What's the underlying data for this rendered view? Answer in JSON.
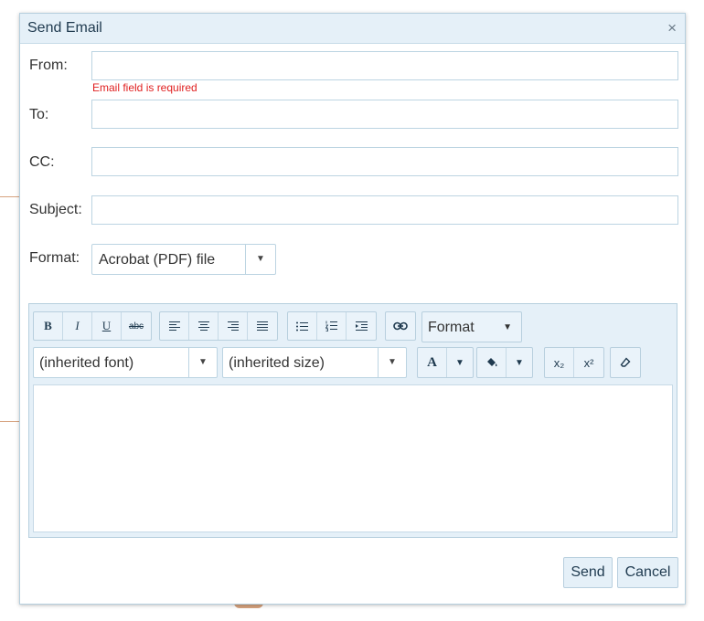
{
  "dialog": {
    "title": "Send Email",
    "close_glyph": "×"
  },
  "form": {
    "from_label": "From:",
    "from_value": "",
    "from_error": "Email field is required",
    "to_label": "To:",
    "to_value": "",
    "cc_label": "CC:",
    "cc_value": "",
    "subject_label": "Subject:",
    "subject_value": "",
    "format_label": "Format:",
    "format_value": "Acrobat (PDF) file"
  },
  "editor": {
    "format_dropdown_label": "Format",
    "font_value": "(inherited font)",
    "size_value": "(inherited size)",
    "body_text": "",
    "icons": {
      "bold": "B",
      "italic": "I",
      "underline": "U",
      "strikethrough": "abc",
      "font_color": "A",
      "subscript": "x₂",
      "superscript": "x²"
    },
    "dropdown_arrow": "▼"
  },
  "actions": {
    "send_label": "Send",
    "cancel_label": "Cancel"
  },
  "colors": {
    "titlebar": "#e5f0f8",
    "border": "#b6cfde",
    "error": "#e02020"
  }
}
